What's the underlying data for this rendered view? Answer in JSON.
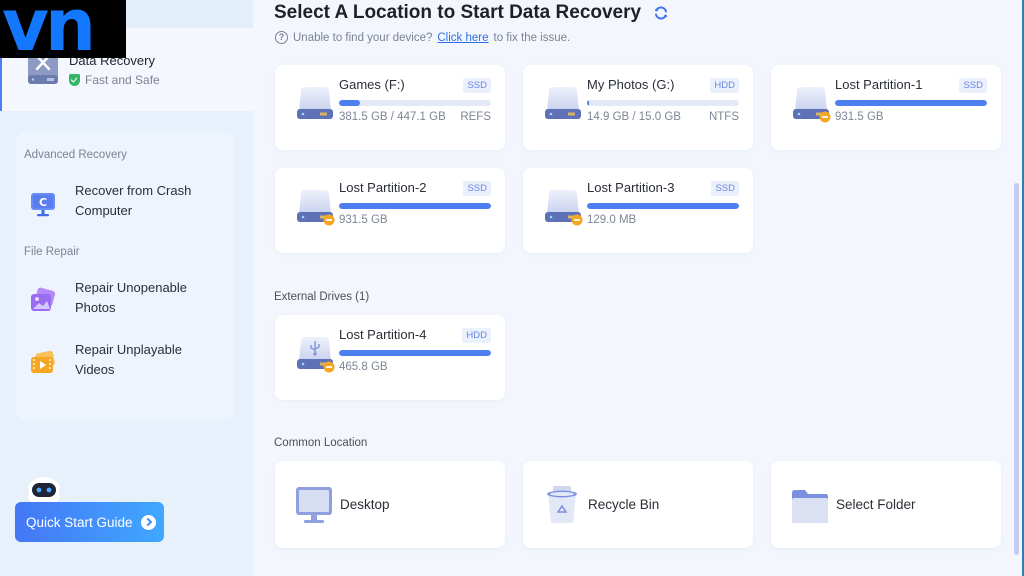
{
  "watermark": {
    "text": "vn"
  },
  "sidebar": {
    "selected": {
      "title": "Data Recovery",
      "subtitle": "Fast and Safe",
      "icon": "drive-tools-icon"
    },
    "sections": [
      {
        "label": "Advanced Recovery",
        "items": [
          {
            "label": "Recover from Crash Computer",
            "line1": "Recover from Crash",
            "line2": "Computer",
            "icon": "crash-computer-icon"
          }
        ]
      },
      {
        "label": "File Repair",
        "items": [
          {
            "label": "Repair Unopenable Photos",
            "line1": "Repair Unopenable",
            "line2": "Photos",
            "icon": "photo-repair-icon"
          },
          {
            "label": "Repair Unplayable Videos",
            "line1": "Repair Unplayable",
            "line2": "Videos",
            "icon": "video-repair-icon"
          }
        ]
      }
    ],
    "quick_start": {
      "label": "Quick Start Guide",
      "icon": "chevron-right-icon"
    }
  },
  "header": {
    "title": "Select A Location to Start Data Recovery",
    "refresh_icon": "refresh-icon",
    "hint_prefix": "Unable to find your device?",
    "hint_link": "Click here",
    "hint_suffix": "to fix the issue."
  },
  "drives": [
    {
      "name": "Games (F:)",
      "type": "SSD",
      "used": "381.5 GB",
      "total": "447.1 GB",
      "size_text": "381.5 GB / 447.1 GB",
      "fs": "REFS",
      "bar_percent": 14,
      "lost": false,
      "usb": false
    },
    {
      "name": "My Photos (G:)",
      "type": "HDD",
      "used": "14.9 GB",
      "total": "15.0 GB",
      "size_text": "14.9 GB / 15.0 GB",
      "fs": "NTFS",
      "bar_percent": 1,
      "lost": false,
      "usb": false
    },
    {
      "name": "Lost Partition-1",
      "type": "SSD",
      "size_text": "931.5 GB",
      "fs": "",
      "bar_percent": 100,
      "lost": true,
      "usb": false
    },
    {
      "name": "Lost Partition-2",
      "type": "SSD",
      "size_text": "931.5 GB",
      "fs": "",
      "bar_percent": 100,
      "lost": true,
      "usb": false
    },
    {
      "name": "Lost Partition-3",
      "type": "SSD",
      "size_text": "129.0 MB",
      "fs": "",
      "bar_percent": 100,
      "lost": true,
      "usb": false
    }
  ],
  "external": {
    "label": "External Drives (1)",
    "drives": [
      {
        "name": "Lost Partition-4",
        "type": "HDD",
        "size_text": "465.8 GB",
        "fs": "",
        "bar_percent": 100,
        "lost": true,
        "usb": true
      }
    ]
  },
  "common": {
    "label": "Common Location",
    "items": [
      {
        "label": "Desktop",
        "icon": "desktop-icon"
      },
      {
        "label": "Recycle Bin",
        "icon": "recycle-bin-icon"
      },
      {
        "label": "Select Folder",
        "icon": "folder-icon"
      }
    ]
  },
  "colors": {
    "accent": "#4d7ff0",
    "lost_badge": "#f5a623",
    "safe": "#35b46a"
  }
}
